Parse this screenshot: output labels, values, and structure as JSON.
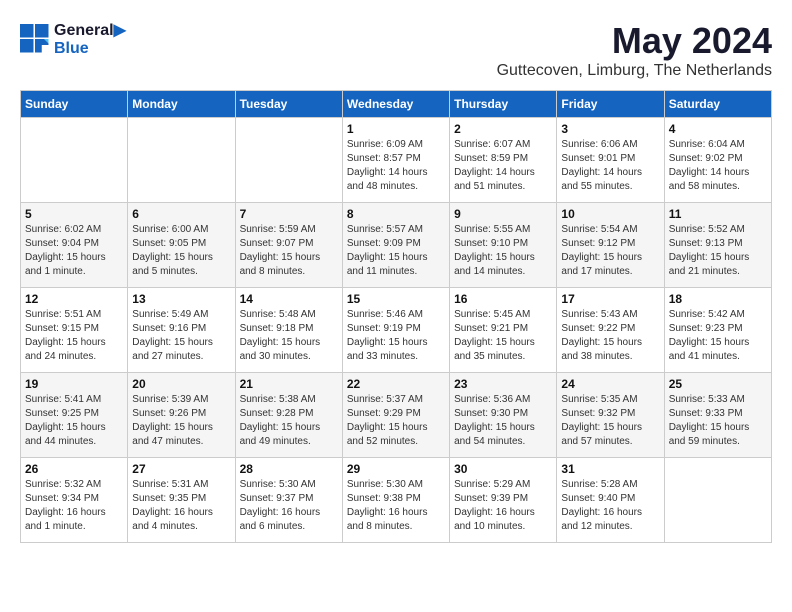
{
  "header": {
    "logo_line1": "General",
    "logo_line2": "Blue",
    "month_year": "May 2024",
    "location": "Guttecoven, Limburg, The Netherlands"
  },
  "weekdays": [
    "Sunday",
    "Monday",
    "Tuesday",
    "Wednesday",
    "Thursday",
    "Friday",
    "Saturday"
  ],
  "weeks": [
    [
      {
        "day": "",
        "info": ""
      },
      {
        "day": "",
        "info": ""
      },
      {
        "day": "",
        "info": ""
      },
      {
        "day": "1",
        "info": "Sunrise: 6:09 AM\nSunset: 8:57 PM\nDaylight: 14 hours\nand 48 minutes."
      },
      {
        "day": "2",
        "info": "Sunrise: 6:07 AM\nSunset: 8:59 PM\nDaylight: 14 hours\nand 51 minutes."
      },
      {
        "day": "3",
        "info": "Sunrise: 6:06 AM\nSunset: 9:01 PM\nDaylight: 14 hours\nand 55 minutes."
      },
      {
        "day": "4",
        "info": "Sunrise: 6:04 AM\nSunset: 9:02 PM\nDaylight: 14 hours\nand 58 minutes."
      }
    ],
    [
      {
        "day": "5",
        "info": "Sunrise: 6:02 AM\nSunset: 9:04 PM\nDaylight: 15 hours\nand 1 minute."
      },
      {
        "day": "6",
        "info": "Sunrise: 6:00 AM\nSunset: 9:05 PM\nDaylight: 15 hours\nand 5 minutes."
      },
      {
        "day": "7",
        "info": "Sunrise: 5:59 AM\nSunset: 9:07 PM\nDaylight: 15 hours\nand 8 minutes."
      },
      {
        "day": "8",
        "info": "Sunrise: 5:57 AM\nSunset: 9:09 PM\nDaylight: 15 hours\nand 11 minutes."
      },
      {
        "day": "9",
        "info": "Sunrise: 5:55 AM\nSunset: 9:10 PM\nDaylight: 15 hours\nand 14 minutes."
      },
      {
        "day": "10",
        "info": "Sunrise: 5:54 AM\nSunset: 9:12 PM\nDaylight: 15 hours\nand 17 minutes."
      },
      {
        "day": "11",
        "info": "Sunrise: 5:52 AM\nSunset: 9:13 PM\nDaylight: 15 hours\nand 21 minutes."
      }
    ],
    [
      {
        "day": "12",
        "info": "Sunrise: 5:51 AM\nSunset: 9:15 PM\nDaylight: 15 hours\nand 24 minutes."
      },
      {
        "day": "13",
        "info": "Sunrise: 5:49 AM\nSunset: 9:16 PM\nDaylight: 15 hours\nand 27 minutes."
      },
      {
        "day": "14",
        "info": "Sunrise: 5:48 AM\nSunset: 9:18 PM\nDaylight: 15 hours\nand 30 minutes."
      },
      {
        "day": "15",
        "info": "Sunrise: 5:46 AM\nSunset: 9:19 PM\nDaylight: 15 hours\nand 33 minutes."
      },
      {
        "day": "16",
        "info": "Sunrise: 5:45 AM\nSunset: 9:21 PM\nDaylight: 15 hours\nand 35 minutes."
      },
      {
        "day": "17",
        "info": "Sunrise: 5:43 AM\nSunset: 9:22 PM\nDaylight: 15 hours\nand 38 minutes."
      },
      {
        "day": "18",
        "info": "Sunrise: 5:42 AM\nSunset: 9:23 PM\nDaylight: 15 hours\nand 41 minutes."
      }
    ],
    [
      {
        "day": "19",
        "info": "Sunrise: 5:41 AM\nSunset: 9:25 PM\nDaylight: 15 hours\nand 44 minutes."
      },
      {
        "day": "20",
        "info": "Sunrise: 5:39 AM\nSunset: 9:26 PM\nDaylight: 15 hours\nand 47 minutes."
      },
      {
        "day": "21",
        "info": "Sunrise: 5:38 AM\nSunset: 9:28 PM\nDaylight: 15 hours\nand 49 minutes."
      },
      {
        "day": "22",
        "info": "Sunrise: 5:37 AM\nSunset: 9:29 PM\nDaylight: 15 hours\nand 52 minutes."
      },
      {
        "day": "23",
        "info": "Sunrise: 5:36 AM\nSunset: 9:30 PM\nDaylight: 15 hours\nand 54 minutes."
      },
      {
        "day": "24",
        "info": "Sunrise: 5:35 AM\nSunset: 9:32 PM\nDaylight: 15 hours\nand 57 minutes."
      },
      {
        "day": "25",
        "info": "Sunrise: 5:33 AM\nSunset: 9:33 PM\nDaylight: 15 hours\nand 59 minutes."
      }
    ],
    [
      {
        "day": "26",
        "info": "Sunrise: 5:32 AM\nSunset: 9:34 PM\nDaylight: 16 hours\nand 1 minute."
      },
      {
        "day": "27",
        "info": "Sunrise: 5:31 AM\nSunset: 9:35 PM\nDaylight: 16 hours\nand 4 minutes."
      },
      {
        "day": "28",
        "info": "Sunrise: 5:30 AM\nSunset: 9:37 PM\nDaylight: 16 hours\nand 6 minutes."
      },
      {
        "day": "29",
        "info": "Sunrise: 5:30 AM\nSunset: 9:38 PM\nDaylight: 16 hours\nand 8 minutes."
      },
      {
        "day": "30",
        "info": "Sunrise: 5:29 AM\nSunset: 9:39 PM\nDaylight: 16 hours\nand 10 minutes."
      },
      {
        "day": "31",
        "info": "Sunrise: 5:28 AM\nSunset: 9:40 PM\nDaylight: 16 hours\nand 12 minutes."
      },
      {
        "day": "",
        "info": ""
      }
    ]
  ]
}
